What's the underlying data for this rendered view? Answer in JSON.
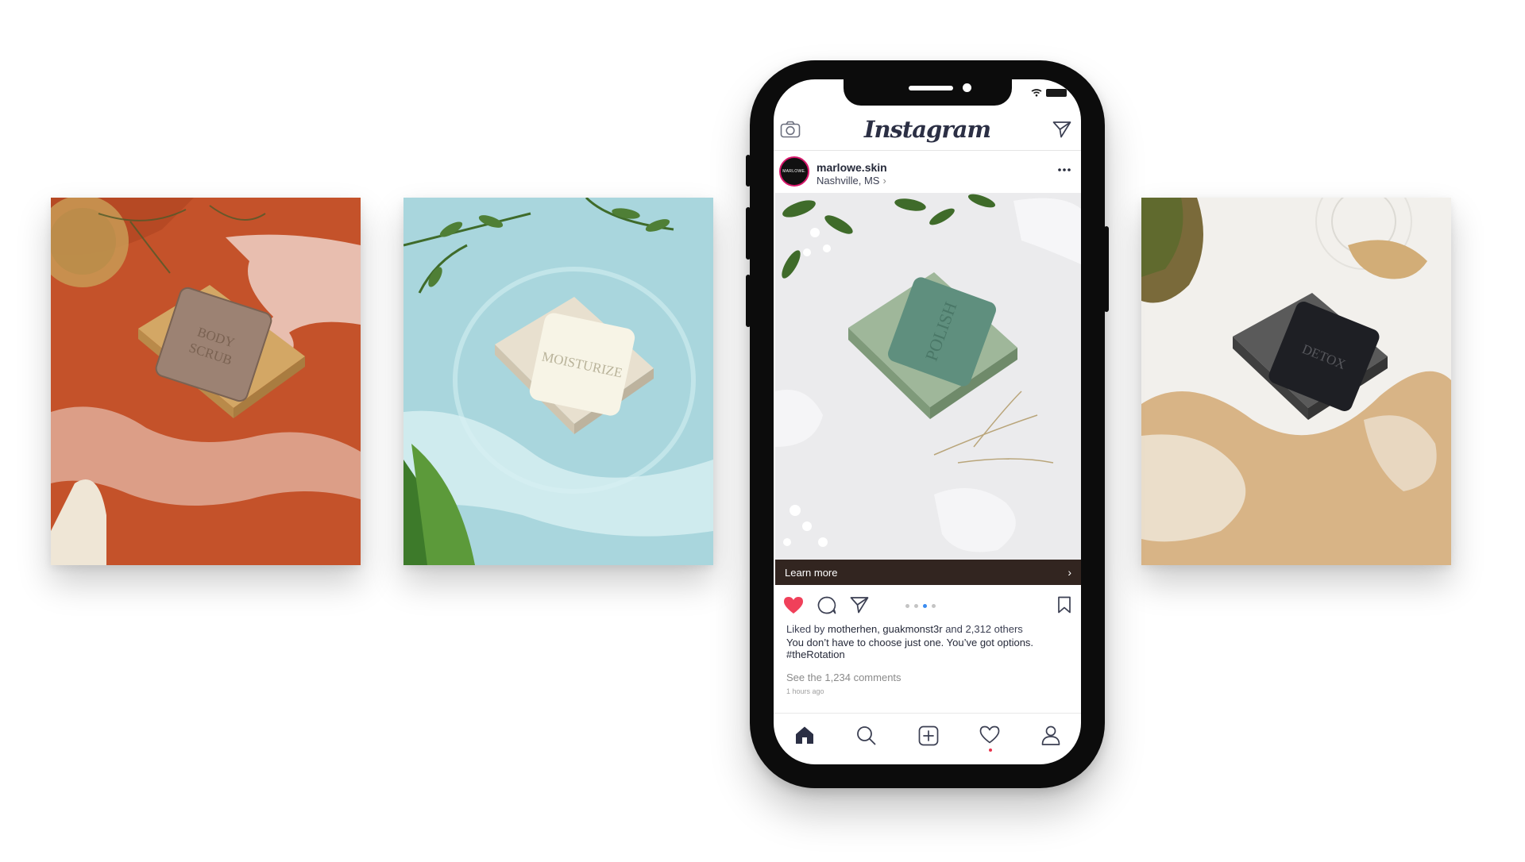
{
  "cards": [
    {
      "soap_stamp_line1": "BODY",
      "soap_stamp_line2": "SCRUB",
      "background": "#c4522a"
    },
    {
      "soap_stamp": "MOISTURIZE",
      "background": "#a9d6dd"
    },
    {
      "soap_stamp": "DETOX",
      "background": "#f2f0ec"
    }
  ],
  "instagram": {
    "logo_text": "Instagram",
    "post": {
      "username": "marlowe.skin",
      "location": "Nashville, MS",
      "avatar_text": "MARLOWE.",
      "image_soap_stamp": "POLISH",
      "cta_label": "Learn more",
      "carousel": {
        "count": 4,
        "active_index": 2
      },
      "likes_prefix": "Liked by",
      "likes_users": "motherhen, guakmonst3r",
      "likes_suffix": "and 2,312 others",
      "caption": "You don’t have to choose just one. You’ve got options.",
      "hashtag": "#theRotation",
      "comments_link": "See the 1,234 comments",
      "time_ago": "1 hours ago"
    },
    "icons": {
      "header": [
        "camera-icon",
        "direct-message-icon"
      ],
      "actions": [
        "heart-icon",
        "comment-icon",
        "share-icon",
        "bookmark-icon"
      ],
      "nav": [
        "home-icon",
        "search-icon",
        "add-icon",
        "activity-heart-icon",
        "profile-icon"
      ]
    },
    "colors": {
      "heart": "#f0405a",
      "active_dot": "#3a8bf0",
      "cta_bar": "#322520",
      "text": "#262a3a"
    }
  }
}
